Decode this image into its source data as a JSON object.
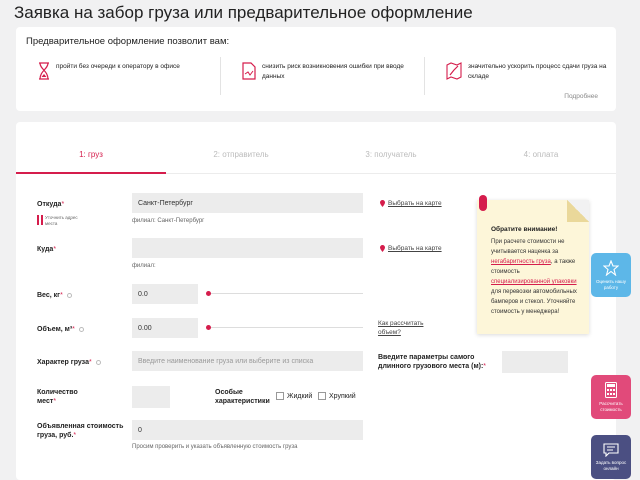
{
  "page": {
    "title": "Заявка на забор груза или предварительное оформление"
  },
  "info": {
    "heading": "Предварительное оформление позволит вам:",
    "benefits": [
      {
        "icon": "hourglass-icon",
        "text": "пройти без очереди к оператору в офисе"
      },
      {
        "icon": "document-icon",
        "text": "снизить риск возникновения ошибки при вводе данных"
      },
      {
        "icon": "map-icon",
        "text": "значительно ускорить процесс сдачи груза на складе"
      }
    ],
    "more_link": "Подробнее"
  },
  "steps": [
    {
      "label": "1: груз",
      "active": true
    },
    {
      "label": "2: отправитель",
      "active": false
    },
    {
      "label": "3: получатель",
      "active": false
    },
    {
      "label": "4: оплата",
      "active": false
    }
  ],
  "form": {
    "from_label": "Откуда",
    "from_value": "Санкт-Петербург",
    "from_branch": "филиал: Санкт-Петербург",
    "from_hint": "Уточнить адрес места",
    "to_label": "Куда",
    "to_value": "",
    "to_branch": "филиал:",
    "map_link": "Выбрать на карте",
    "weight_label": "Вес, кг",
    "weight_value": "0.0",
    "volume_label": "Объем, м³",
    "volume_value": "0.00",
    "calc_link": "Как рассчитать объем?",
    "cargo_type_label": "Характер груза",
    "cargo_type_placeholder": "Введите наименование груза или выберите из списка",
    "dims_label": "Введите параметры самого длинного грузового места (м):",
    "qty_label": "Количество мест",
    "special_label": "Особые характеристики",
    "liquid_label": "Жидкий",
    "fragile_label": "Хрупкий",
    "declared_label": "Объявленная стоимость груза, руб.",
    "declared_value": "0",
    "declared_hint": "Просим проверить и указать объявленную стоимость груза",
    "required_mark": "*"
  },
  "note": {
    "title": "Обратите внимание!",
    "body_1": "При расчете стоимости не учитывается наценка за",
    "body_hl_1": "негабаритность груза",
    "body_2": ", а также стоимость",
    "body_hl_2": "специализированной упаковки",
    "body_3": "для перевозки автомобильных бамперов и стекол. Уточняйте стоимость у менеджера!"
  },
  "fabs": [
    {
      "icon": "star-icon",
      "label": "Оценить нашу работу",
      "color": "#5db7e8"
    },
    {
      "icon": "calculator-icon",
      "label": "Рассчитать стоимость",
      "color": "#e14a7a"
    },
    {
      "icon": "chat-icon",
      "label": "Задать вопрос онлайн",
      "color": "#4b4f82"
    }
  ],
  "colors": {
    "accent": "#d51d4c"
  }
}
